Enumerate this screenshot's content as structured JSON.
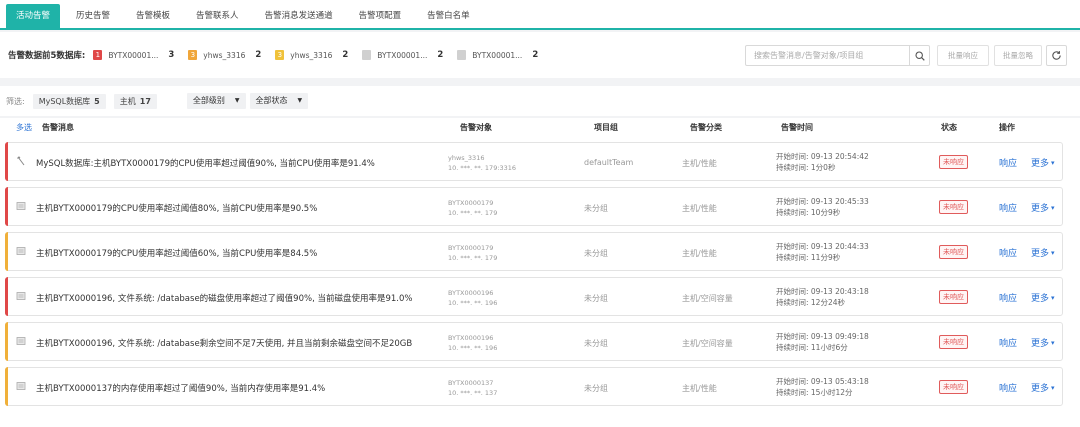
{
  "tabs": [
    {
      "label": "活动告警",
      "active": true
    },
    {
      "label": "历史告警",
      "active": false
    },
    {
      "label": "告警模板",
      "active": false
    },
    {
      "label": "告警联系人",
      "active": false
    },
    {
      "label": "告警消息发送通道",
      "active": false
    },
    {
      "label": "告警项配置",
      "active": false
    },
    {
      "label": "告警白名单",
      "active": false
    }
  ],
  "summary": {
    "title": "告警数据前5数据库:",
    "items": [
      {
        "sev": "1",
        "color": "#e04848",
        "name": "BYTX00001...",
        "count": "3"
      },
      {
        "sev": "3",
        "color": "#f0a63a",
        "name": "yhws_3316",
        "count": "2"
      },
      {
        "sev": "3",
        "color": "#f0c23a",
        "name": "yhws_3316",
        "count": "2"
      },
      {
        "sev": "",
        "color": "#d0d0d0",
        "name": "BYTX00001...",
        "count": "2"
      },
      {
        "sev": "",
        "color": "#d0d0d0",
        "name": "BYTX00001...",
        "count": "2"
      }
    ],
    "search_placeholder": "搜索告警消息/告警对象/项目组",
    "bulk_respond": "批量响应",
    "bulk_ignore": "批量忽略"
  },
  "filters": {
    "label": "筛选:",
    "chips": [
      {
        "name": "MySQL数据库",
        "count": "5"
      },
      {
        "name": "主机",
        "count": "17"
      }
    ],
    "level": "全部级别",
    "state": "全部状态"
  },
  "table": {
    "multi_select": "多选",
    "headers": {
      "message": "告警消息",
      "object": "告警对象",
      "group": "项目组",
      "category": "告警分类",
      "time": "告警时间",
      "status": "状态",
      "action": "操作"
    },
    "rows": [
      {
        "color": "#e04848",
        "icon": "db",
        "message": "MySQL数据库:主机BYTX0000179的CPU使用率超过阈值90%, 当前CPU使用率是91.4%",
        "obj1": "yhws_3316",
        "obj2": "10. ***. **. 179:3316",
        "group": "defaultTeam",
        "category": "主机/性能",
        "start": "开始时间: 09-13 20:54:42",
        "duration": "持续时间: 1分0秒",
        "status": "未响应",
        "respond": "响应",
        "more": "更多"
      },
      {
        "color": "#e04848",
        "icon": "host",
        "message": "主机BYTX0000179的CPU使用率超过阈值80%, 当前CPU使用率是90.5%",
        "obj1": "BYTX0000179",
        "obj2": "10. ***. **. 179",
        "group": "未分组",
        "category": "主机/性能",
        "start": "开始时间: 09-13 20:45:33",
        "duration": "持续时间: 10分9秒",
        "status": "未响应",
        "respond": "响应",
        "more": "更多"
      },
      {
        "color": "#f0b03a",
        "icon": "host",
        "message": "主机BYTX0000179的CPU使用率超过阈值60%, 当前CPU使用率是84.5%",
        "obj1": "BYTX0000179",
        "obj2": "10. ***. **. 179",
        "group": "未分组",
        "category": "主机/性能",
        "start": "开始时间: 09-13 20:44:33",
        "duration": "持续时间: 11分9秒",
        "status": "未响应",
        "respond": "响应",
        "more": "更多"
      },
      {
        "color": "#e04848",
        "icon": "host",
        "message": "主机BYTX0000196, 文件系统: /database的磁盘使用率超过了阈值90%, 当前磁盘使用率是91.0%",
        "obj1": "BYTX0000196",
        "obj2": "10. ***. **. 196",
        "group": "未分组",
        "category": "主机/空间容量",
        "start": "开始时间: 09-13 20:43:18",
        "duration": "持续时间: 12分24秒",
        "status": "未响应",
        "respond": "响应",
        "more": "更多"
      },
      {
        "color": "#f0b03a",
        "icon": "host",
        "message": "主机BYTX0000196, 文件系统: /database剩余空间不足7天使用, 并且当前剩余磁盘空间不足20GB",
        "obj1": "BYTX0000196",
        "obj2": "10. ***. **. 196",
        "group": "未分组",
        "category": "主机/空间容量",
        "start": "开始时间: 09-13 09:49:18",
        "duration": "持续时间: 11小时6分",
        "status": "未响应",
        "respond": "响应",
        "more": "更多"
      },
      {
        "color": "#f0b03a",
        "icon": "host",
        "message": "主机BYTX0000137的内存使用率超过了阈值90%, 当前内存使用率是91.4%",
        "obj1": "BYTX0000137",
        "obj2": "10. ***. **. 137",
        "group": "未分组",
        "category": "主机/性能",
        "start": "开始时间: 09-13 05:43:18",
        "duration": "持续时间: 15小时12分",
        "status": "未响应",
        "respond": "响应",
        "more": "更多"
      }
    ]
  }
}
